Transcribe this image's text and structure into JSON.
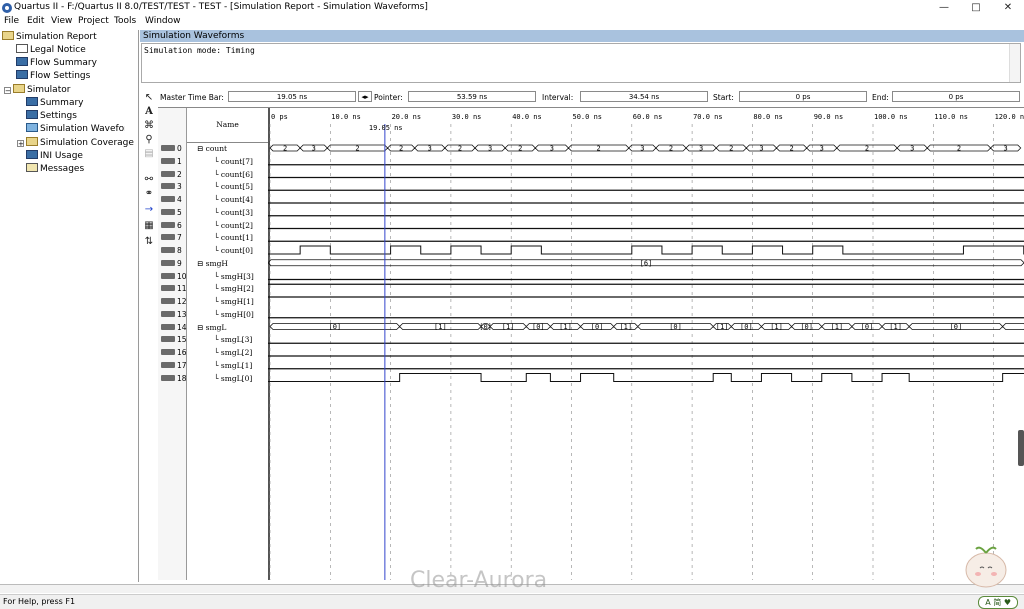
{
  "window": {
    "title": "Quartus II - F:/Quartus II 8.0/TEST/TEST - TEST - [Simulation Report - Simulation Waveforms]",
    "min": "—",
    "max": "□",
    "close": "✕"
  },
  "menu": [
    "File",
    "Edit",
    "View",
    "Project",
    "Tools",
    "Window"
  ],
  "tree": {
    "root": "Simulation Report",
    "items": [
      "Legal Notice",
      "Flow Summary",
      "Flow Settings"
    ],
    "simulator": "Simulator",
    "sim_items": [
      "Summary",
      "Settings",
      "Simulation Waveforms",
      "Simulation Coverage",
      "INI Usage",
      "Messages"
    ]
  },
  "panel": {
    "title": "Simulation Waveforms",
    "mode": "Simulation mode: Timing"
  },
  "timebar": {
    "master_label": "Master Time Bar:",
    "master_value": "19.05 ns",
    "pointer_label": "Pointer:",
    "pointer_value": "53.59 ns",
    "interval_label": "Interval:",
    "interval_value": "34.54 ns",
    "start_label": "Start:",
    "start_value": "0 ps",
    "end_label": "End:",
    "end_value": "0 ps"
  },
  "wave": {
    "name_header": "Name",
    "cursor_label": "19.05 ns",
    "ticks": [
      "0 ps",
      "10.0 ns",
      "20.0 ns",
      "30.0 ns",
      "40.0 ns",
      "50.0 ns",
      "60.0 ns",
      "70.0 ns",
      "80.0 ns",
      "90.0 ns",
      "100.0 ns",
      "110.0 ns",
      "120.0 ns"
    ],
    "signals": [
      {
        "id": "0",
        "name": "count",
        "group": true
      },
      {
        "id": "1",
        "name": "count[7]"
      },
      {
        "id": "2",
        "name": "count[6]"
      },
      {
        "id": "3",
        "name": "count[5]"
      },
      {
        "id": "4",
        "name": "count[4]"
      },
      {
        "id": "5",
        "name": "count[3]"
      },
      {
        "id": "6",
        "name": "count[2]"
      },
      {
        "id": "7",
        "name": "count[1]"
      },
      {
        "id": "8",
        "name": "count[0]"
      },
      {
        "id": "9",
        "name": "smgH",
        "group": true
      },
      {
        "id": "10",
        "name": "smgH[3]"
      },
      {
        "id": "11",
        "name": "smgH[2]"
      },
      {
        "id": "12",
        "name": "smgH[1]"
      },
      {
        "id": "13",
        "name": "smgH[0]"
      },
      {
        "id": "14",
        "name": "smgL",
        "group": true
      },
      {
        "id": "15",
        "name": "smgL[3]"
      },
      {
        "id": "16",
        "name": "smgL[2]"
      },
      {
        "id": "17",
        "name": "smgL[1]"
      },
      {
        "id": "18",
        "name": "smgL[0]"
      }
    ],
    "count_labels": [
      "2",
      "3",
      "2",
      "2",
      "3",
      "2",
      "3",
      "2",
      "3",
      "2",
      "3",
      "2",
      "3",
      "2",
      "3",
      "2",
      "3",
      "2",
      "3",
      "2",
      "3"
    ],
    "smgH_label": "[6]",
    "smgL_labels": [
      "[0]",
      "[1]",
      "[0]",
      "[1]",
      "[0]",
      "[1]",
      "[0]",
      "[1]",
      "[0]",
      "[1]",
      "[0]",
      "[1]",
      "[0]",
      "[1]",
      "[0]",
      "[1]",
      "[0]"
    ]
  },
  "status": {
    "help": "For Help, press F1",
    "ime": "A 简 ♥"
  },
  "watermark": "Clear-Aurora",
  "colors": {
    "cursor": "#3344cc",
    "panel_header": "#a9c2de"
  }
}
